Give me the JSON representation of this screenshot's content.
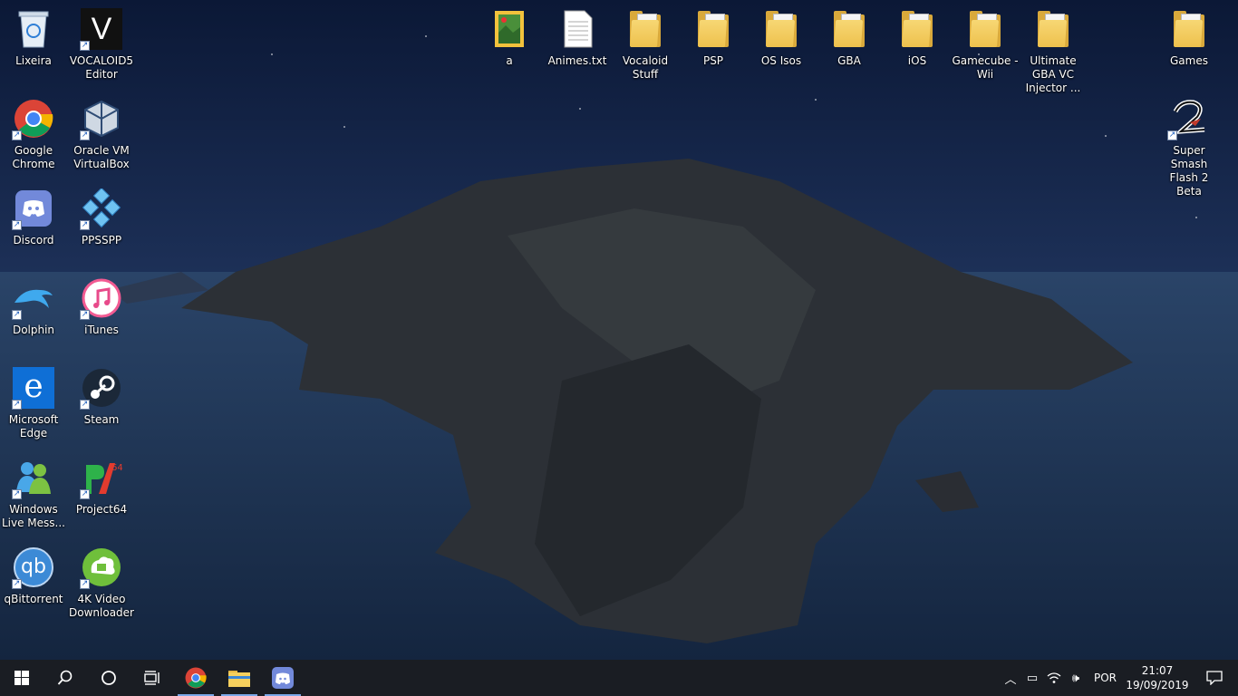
{
  "desktop": {
    "left_icons": [
      {
        "label": "Lixeira",
        "icon": "recycle-bin-icon"
      },
      {
        "label": "VOCALOID5 Editor",
        "icon": "vocaloid-icon"
      },
      {
        "label": "Google Chrome",
        "icon": "chrome-icon"
      },
      {
        "label": "Oracle VM VirtualBox",
        "icon": "virtualbox-icon"
      },
      {
        "label": "Discord",
        "icon": "discord-icon"
      },
      {
        "label": "PPSSPP",
        "icon": "ppsspp-icon"
      },
      {
        "label": "Dolphin",
        "icon": "dolphin-icon"
      },
      {
        "label": "iTunes",
        "icon": "itunes-icon"
      },
      {
        "label": "Microsoft Edge",
        "icon": "edge-icon"
      },
      {
        "label": "Steam",
        "icon": "steam-icon"
      },
      {
        "label": "Windows Live Mess...",
        "icon": "messenger-icon"
      },
      {
        "label": "Project64",
        "icon": "project64-icon"
      },
      {
        "label": "qBittorrent",
        "icon": "qbittorrent-icon"
      },
      {
        "label": "4K Video Downloader",
        "icon": "4k-video-downloader-icon"
      }
    ],
    "top_icons": [
      {
        "label": "a",
        "icon": "image-file-icon"
      },
      {
        "label": "Animes.txt",
        "icon": "text-file-icon"
      },
      {
        "label": "Vocaloid Stuff",
        "icon": "folder-icon"
      },
      {
        "label": "PSP",
        "icon": "folder-icon"
      },
      {
        "label": "OS Isos",
        "icon": "folder-icon"
      },
      {
        "label": "GBA",
        "icon": "folder-icon"
      },
      {
        "label": "iOS",
        "icon": "folder-icon"
      },
      {
        "label": "Gamecube - Wii",
        "icon": "folder-icon"
      },
      {
        "label": "Ultimate GBA VC Injector ...",
        "icon": "folder-icon"
      },
      {
        "label": "Games",
        "icon": "folder-icon"
      }
    ],
    "right_icons": [
      {
        "label": "Super Smash Flash 2 Beta",
        "icon": "ssf2-icon"
      }
    ]
  },
  "taskbar": {
    "start": "windows-start-icon",
    "search": "search-icon",
    "cortana": "cortana-icon",
    "task_view": "task-view-icon",
    "pinned": [
      "chrome-icon",
      "file-explorer-icon",
      "discord-icon"
    ],
    "tray": {
      "language": "POR",
      "time": "21:07",
      "date": "19/09/2019"
    }
  },
  "colors": {
    "sky_top": "#0b1836",
    "sky_bottom": "#243a5e",
    "sea": "#1d3353",
    "island": "#2b2f35",
    "taskbar": "#1a1d23",
    "accent": "#7aa7e8"
  }
}
